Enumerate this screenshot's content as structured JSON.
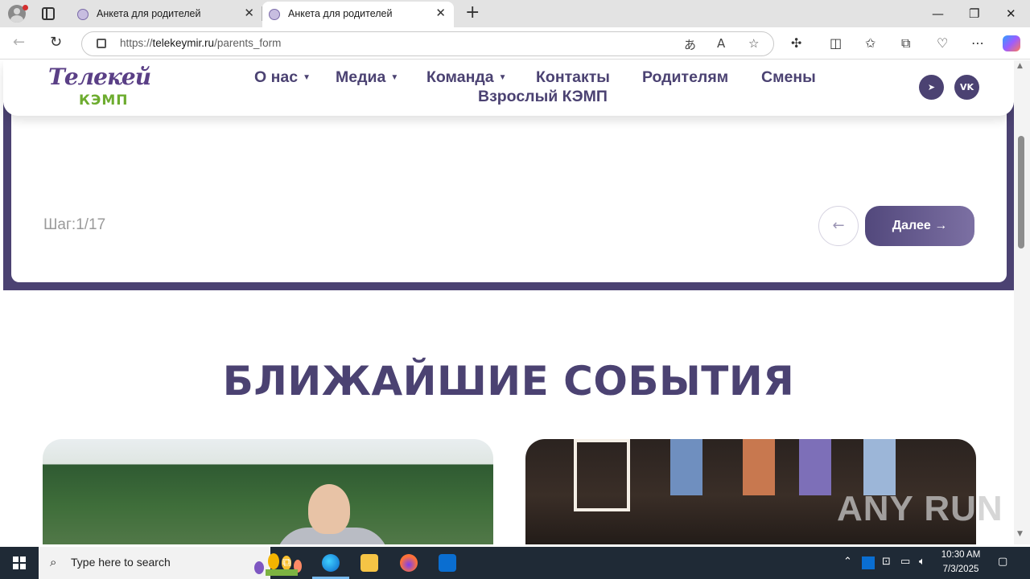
{
  "browser": {
    "tabs": [
      {
        "title": "Анкета для родителей",
        "active": false
      },
      {
        "title": "Анкета для родителей",
        "active": true
      }
    ],
    "url_prefix": "https://",
    "url_domain": "telekeymir.ru",
    "url_path": "/parents_form"
  },
  "site": {
    "logo_top": "Телекей",
    "logo_bottom": "КЭМП",
    "menu": [
      {
        "label": "О нас",
        "has_dropdown": true
      },
      {
        "label": "Медиа",
        "has_dropdown": true
      },
      {
        "label": "Команда",
        "has_dropdown": true
      },
      {
        "label": "Контакты",
        "has_dropdown": false
      },
      {
        "label": "Родителям",
        "has_dropdown": false
      },
      {
        "label": "Смены",
        "has_dropdown": false
      },
      {
        "label": "Взрослый КЭМП",
        "has_dropdown": false
      }
    ],
    "social": [
      "telegram-icon",
      "vk-icon"
    ],
    "social_vk_text": "VK",
    "brand_color": "#4b4272",
    "accent_green": "#6dac2f"
  },
  "form": {
    "step_label": "Шаг:1/17",
    "prev_arrow": "←",
    "next_label": "Далее →"
  },
  "events": {
    "title": "БЛИЖАЙШИЕ СОБЫТИЯ"
  },
  "watermark": "ANY RUN",
  "taskbar": {
    "search_placeholder": "Type here to search",
    "time": "10:30 AM",
    "date": "7/3/2025"
  }
}
